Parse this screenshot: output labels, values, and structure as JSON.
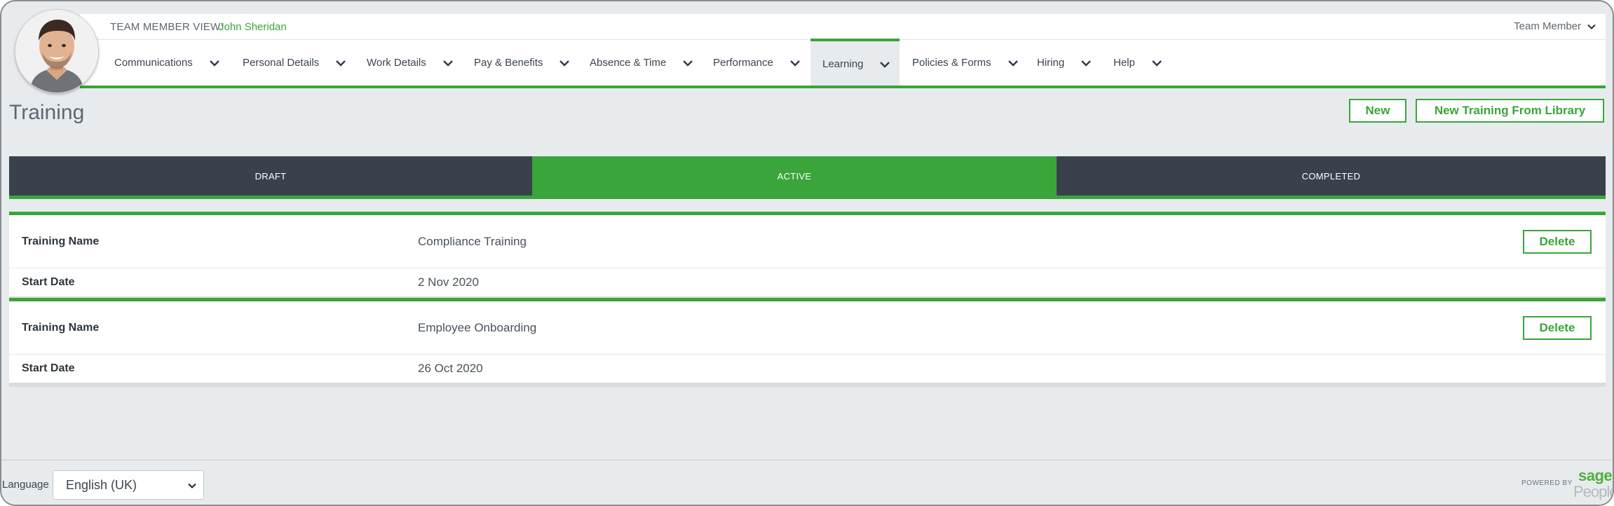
{
  "header": {
    "view_label": "TEAM MEMBER VIEW:",
    "user_name": "John Sheridan",
    "role": "Team Member"
  },
  "nav": {
    "items": [
      {
        "label": "Communications"
      },
      {
        "label": "Personal Details"
      },
      {
        "label": "Work Details"
      },
      {
        "label": "Pay & Benefits"
      },
      {
        "label": "Absence & Time"
      },
      {
        "label": "Performance"
      },
      {
        "label": "Learning",
        "active": true
      },
      {
        "label": "Policies & Forms"
      },
      {
        "label": "Hiring"
      },
      {
        "label": "Help"
      }
    ]
  },
  "page": {
    "title": "Training",
    "new_label": "New",
    "new_from_library_label": "New Training From Library"
  },
  "tabs": [
    {
      "label": "DRAFT"
    },
    {
      "label": "ACTIVE",
      "active": true
    },
    {
      "label": "COMPLETED"
    }
  ],
  "records": [
    {
      "name_label": "Training Name",
      "name": "Compliance Training",
      "date_label": "Start Date",
      "date": "2 Nov 2020",
      "delete_label": "Delete"
    },
    {
      "name_label": "Training Name",
      "name": "Employee Onboarding",
      "date_label": "Start Date",
      "date": "26 Oct 2020",
      "delete_label": "Delete"
    }
  ],
  "footer": {
    "language_label": "Language",
    "language_value": "English (UK)",
    "powered_by": "POWERED BY",
    "logo_top": "sage",
    "logo_bottom": "People"
  },
  "colors": {
    "accent": "#3aa53a",
    "dark_tab": "#3a414c",
    "background": "#e8ebee"
  },
  "icons": {
    "dropdown": "chevron-down-icon",
    "avatar": "user-avatar-photo"
  }
}
